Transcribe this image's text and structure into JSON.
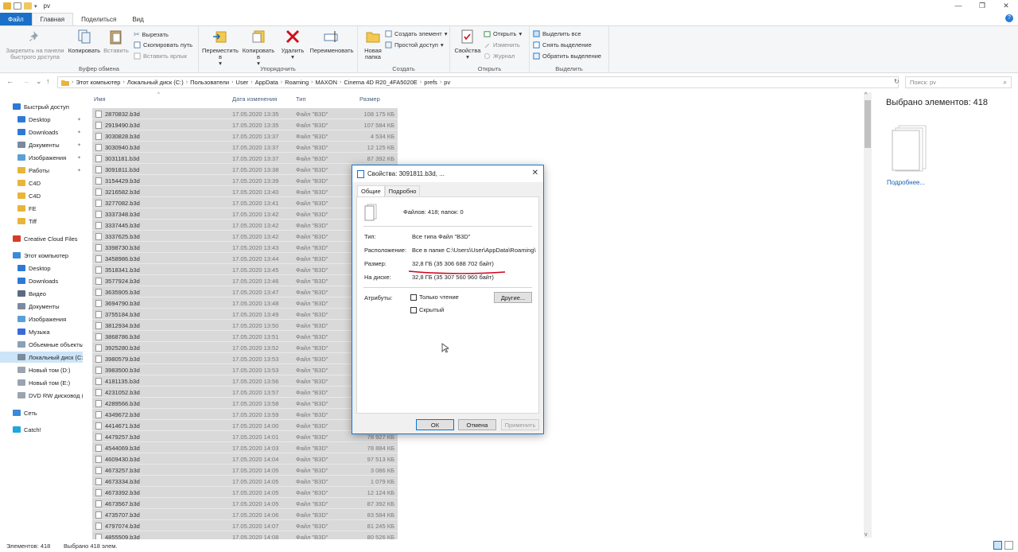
{
  "window": {
    "title": "pv",
    "minimize": "—",
    "maximize": "❐",
    "close": "✕"
  },
  "tabs": [
    "Файл",
    "Главная",
    "Поделиться",
    "Вид"
  ],
  "help_icon": "?",
  "ribbon": {
    "clipboard": {
      "label": "Буфер обмена",
      "pin": "Закрепить на панели быстрого доступа",
      "copy": "Копировать",
      "paste": "Вставить",
      "cut": "Вырезать",
      "copy_path": "Скопировать путь",
      "paste_shortcut": "Вставить ярлык"
    },
    "organize": {
      "label": "Упорядочить",
      "move": "Переместить в",
      "copy_to": "Копировать в",
      "delete": "Удалить",
      "rename": "Переименовать"
    },
    "create": {
      "label": "Создать",
      "new_folder": "Новая папка",
      "new_item": "Создать элемент",
      "easy_access": "Простой доступ"
    },
    "open": {
      "label": "Открыть",
      "properties": "Свойства",
      "open": "Открыть",
      "edit": "Изменить",
      "history": "Журнал"
    },
    "select": {
      "label": "Выделить",
      "select_all": "Выделить все",
      "select_none": "Снять выделение",
      "invert": "Обратить выделение"
    }
  },
  "nav_buttons": {
    "back": "←",
    "forward": "→",
    "recent": "⌄",
    "up": "↑"
  },
  "breadcrumb": [
    "Этот компьютер",
    "Локальный диск (C:)",
    "Пользователи",
    "User",
    "AppData",
    "Roaming",
    "MAXON",
    "Cinema 4D R20_4FA5020E",
    "prefs",
    "pv"
  ],
  "search_placeholder": "Поиск: pv",
  "navpane": {
    "quick_access": "Быстрый доступ",
    "quick_items": [
      "Desktop",
      "Downloads",
      "Документы",
      "Изображения",
      "Работы",
      "C4D",
      "C4D",
      "FE",
      "Tiff"
    ],
    "creative_cloud": "Creative Cloud Files",
    "this_pc": "Этот компьютер",
    "pc_items": [
      "Desktop",
      "Downloads",
      "Видео",
      "Документы",
      "Изображения",
      "Музыка",
      "Объемные объекты",
      "Локальный диск (C:)",
      "Новый том (D:)",
      "Новый том (E:)",
      "DVD RW дисковод (F:)"
    ],
    "network": "Сеть",
    "catch": "Catch!"
  },
  "columns": {
    "name": "Имя",
    "date": "Дата изменения",
    "type": "Тип",
    "size": "Размер"
  },
  "files": [
    {
      "name": "2870832.b3d",
      "date": "17.05.2020 13:35",
      "type": "Файл \"B3D\"",
      "size": "108 175 КБ"
    },
    {
      "name": "2919490.b3d",
      "date": "17.05.2020 13:35",
      "type": "Файл \"B3D\"",
      "size": "107 584 КБ"
    },
    {
      "name": "3030828.b3d",
      "date": "17.05.2020 13:37",
      "type": "Файл \"B3D\"",
      "size": "4 534 КБ"
    },
    {
      "name": "3030940.b3d",
      "date": "17.05.2020 13:37",
      "type": "Файл \"B3D\"",
      "size": "12 125 КБ"
    },
    {
      "name": "3031181.b3d",
      "date": "17.05.2020 13:37",
      "type": "Файл \"B3D\"",
      "size": "87 392 КБ"
    },
    {
      "name": "3091811.b3d",
      "date": "17.05.2020 13:38",
      "type": "Файл \"B3D\"",
      "size": ""
    },
    {
      "name": "3154429.b3d",
      "date": "17.05.2020 13:39",
      "type": "Файл \"B3D\"",
      "size": ""
    },
    {
      "name": "3216582.b3d",
      "date": "17.05.2020 13:40",
      "type": "Файл \"B3D\"",
      "size": ""
    },
    {
      "name": "3277082.b3d",
      "date": "17.05.2020 13:41",
      "type": "Файл \"B3D\"",
      "size": ""
    },
    {
      "name": "3337348.b3d",
      "date": "17.05.2020 13:42",
      "type": "Файл \"B3D\"",
      "size": ""
    },
    {
      "name": "3337445.b3d",
      "date": "17.05.2020 13:42",
      "type": "Файл \"B3D\"",
      "size": ""
    },
    {
      "name": "3337625.b3d",
      "date": "17.05.2020 13:42",
      "type": "Файл \"B3D\"",
      "size": ""
    },
    {
      "name": "3398730.b3d",
      "date": "17.05.2020 13:43",
      "type": "Файл \"B3D\"",
      "size": ""
    },
    {
      "name": "3458986.b3d",
      "date": "17.05.2020 13:44",
      "type": "Файл \"B3D\"",
      "size": ""
    },
    {
      "name": "3518341.b3d",
      "date": "17.05.2020 13:45",
      "type": "Файл \"B3D\"",
      "size": ""
    },
    {
      "name": "3577924.b3d",
      "date": "17.05.2020 13:46",
      "type": "Файл \"B3D\"",
      "size": ""
    },
    {
      "name": "3635905.b3d",
      "date": "17.05.2020 13:47",
      "type": "Файл \"B3D\"",
      "size": ""
    },
    {
      "name": "3694790.b3d",
      "date": "17.05.2020 13:48",
      "type": "Файл \"B3D\"",
      "size": ""
    },
    {
      "name": "3755184.b3d",
      "date": "17.05.2020 13:49",
      "type": "Файл \"B3D\"",
      "size": ""
    },
    {
      "name": "3812934.b3d",
      "date": "17.05.2020 13:50",
      "type": "Файл \"B3D\"",
      "size": ""
    },
    {
      "name": "3868786.b3d",
      "date": "17.05.2020 13:51",
      "type": "Файл \"B3D\"",
      "size": ""
    },
    {
      "name": "3925280.b3d",
      "date": "17.05.2020 13:52",
      "type": "Файл \"B3D\"",
      "size": ""
    },
    {
      "name": "3980579.b3d",
      "date": "17.05.2020 13:53",
      "type": "Файл \"B3D\"",
      "size": ""
    },
    {
      "name": "3983500.b3d",
      "date": "17.05.2020 13:53",
      "type": "Файл \"B3D\"",
      "size": ""
    },
    {
      "name": "4181135.b3d",
      "date": "17.05.2020 13:56",
      "type": "Файл \"B3D\"",
      "size": ""
    },
    {
      "name": "4231052.b3d",
      "date": "17.05.2020 13:57",
      "type": "Файл \"B3D\"",
      "size": ""
    },
    {
      "name": "4289566.b3d",
      "date": "17.05.2020 13:58",
      "type": "Файл \"B3D\"",
      "size": ""
    },
    {
      "name": "4349672.b3d",
      "date": "17.05.2020 13:59",
      "type": "Файл \"B3D\"",
      "size": ""
    },
    {
      "name": "4414671.b3d",
      "date": "17.05.2020 14:00",
      "type": "Файл \"B3D\"",
      "size": ""
    },
    {
      "name": "4479257.b3d",
      "date": "17.05.2020 14:01",
      "type": "Файл \"B3D\"",
      "size": "78 927 КБ"
    },
    {
      "name": "4544069.b3d",
      "date": "17.05.2020 14:03",
      "type": "Файл \"B3D\"",
      "size": "78 884 КБ"
    },
    {
      "name": "4609430.b3d",
      "date": "17.05.2020 14:04",
      "type": "Файл \"B3D\"",
      "size": "97 513 КБ"
    },
    {
      "name": "4673257.b3d",
      "date": "17.05.2020 14:05",
      "type": "Файл \"B3D\"",
      "size": "3 086 КБ"
    },
    {
      "name": "4673334.b3d",
      "date": "17.05.2020 14:05",
      "type": "Файл \"B3D\"",
      "size": "1 079 КБ"
    },
    {
      "name": "4673392.b3d",
      "date": "17.05.2020 14:05",
      "type": "Файл \"B3D\"",
      "size": "12 124 КБ"
    },
    {
      "name": "4673567.b3d",
      "date": "17.05.2020 14:05",
      "type": "Файл \"B3D\"",
      "size": "87 392 КБ"
    },
    {
      "name": "4735707.b3d",
      "date": "17.05.2020 14:06",
      "type": "Файл \"B3D\"",
      "size": "83 584 КБ"
    },
    {
      "name": "4797074.b3d",
      "date": "17.05.2020 14:07",
      "type": "Файл \"B3D\"",
      "size": "81 245 КБ"
    },
    {
      "name": "4855509.b3d",
      "date": "17.05.2020 14:08",
      "type": "Файл \"B3D\"",
      "size": "80 526 КБ"
    }
  ],
  "details": {
    "count": "Выбрано элементов: 418",
    "more": "Подробнее..."
  },
  "status": {
    "items": "Элементов: 418",
    "selected": "Выбрано 418 элем."
  },
  "dialog": {
    "title": "Свойства: 3091811.b3d, ...",
    "close": "✕",
    "tabs": [
      "Общие",
      "Подробно"
    ],
    "summary": "Файлов: 418; папок: 0",
    "type_label": "Тип:",
    "type_value": "Все типа Файл \"B3D\"",
    "location_label": "Расположение:",
    "location_value": "Все в папке C:\\Users\\User\\AppData\\Roaming\\M",
    "size_label": "Размер:",
    "size_value": "32,8 ГБ (35 306 688 702 байт)",
    "disk_label": "На диске:",
    "disk_value": "32,8 ГБ (35 307 560 960 байт)",
    "attributes_label": "Атрибуты:",
    "readonly": "Только чтение",
    "hidden": "Скрытый",
    "other_button": "Другие...",
    "ok": "ОК",
    "cancel": "Отмена",
    "apply": "Применить"
  },
  "colors": {
    "accent": "#1a6fc7",
    "selection_row": "#d9d9d9",
    "dialog_border": "#1a78d4",
    "annotation": "#d0021b"
  }
}
